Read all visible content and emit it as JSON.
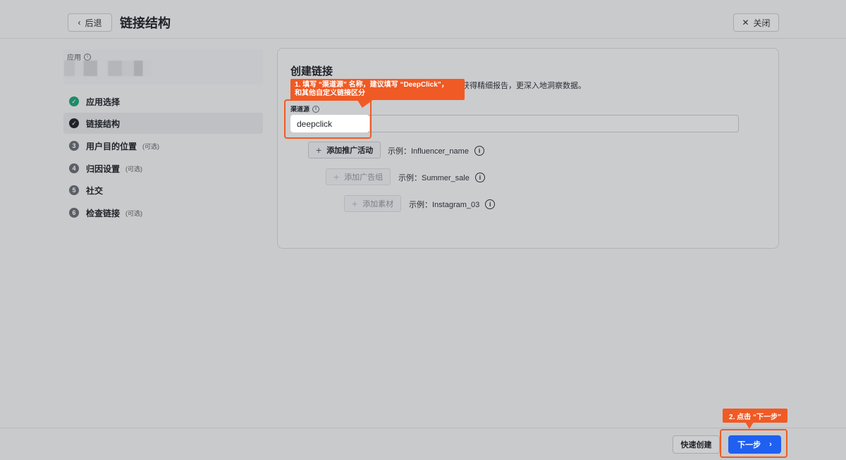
{
  "header": {
    "back_label": "后退",
    "title": "链接结构",
    "close_label": "关闭"
  },
  "sidebar": {
    "app_label": "应用",
    "steps": [
      {
        "num": "",
        "label": "应用选择",
        "optional": "",
        "status": "done"
      },
      {
        "num": "",
        "label": "链接结构",
        "optional": "",
        "status": "current"
      },
      {
        "num": "3",
        "label": "用户目的位置",
        "optional": "(可选)",
        "status": "todo"
      },
      {
        "num": "4",
        "label": "归因设置",
        "optional": "(可选)",
        "status": "todo"
      },
      {
        "num": "5",
        "label": "社交",
        "optional": "",
        "status": "todo"
      },
      {
        "num": "6",
        "label": "检查链接",
        "optional": "(可选)",
        "status": "todo"
      }
    ]
  },
  "card": {
    "title": "创建链接",
    "description": "获得精细报告，更深入地洞察数据。",
    "field_label": "渠道源",
    "field_value": "deepclick",
    "add_campaign": {
      "label": "添加推广活动",
      "example": "示例：Influencer_name"
    },
    "add_adgroup": {
      "label": "添加广告组",
      "example": "示例：Summer_sale"
    },
    "add_creative": {
      "label": "添加素材",
      "example": "示例：Instagram_03"
    }
  },
  "callouts": {
    "step1_line1": "1. 填写 “渠道源” 名称，建议填写 “DeepClick”，",
    "step1_line2": "和其他自定义链接区分",
    "step2": "2. 点击 “下一步”"
  },
  "footer": {
    "quick_create": "快速创建",
    "next": "下一步"
  },
  "colors": {
    "accent": "#2060f0",
    "callout": "#f05a24",
    "done": "#1f8a6a"
  }
}
